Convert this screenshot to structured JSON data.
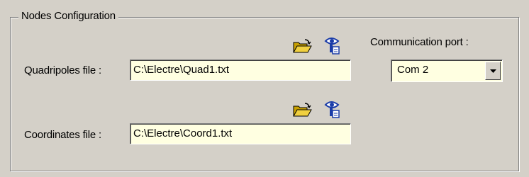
{
  "group": {
    "title": "Nodes Configuration"
  },
  "quadripoles": {
    "label": "Quadripoles file :",
    "value": "C:\\Electre\\Quad1.txt",
    "open_icon": "folder-open-icon",
    "view_icon": "view-file-icon"
  },
  "coordinates": {
    "label": "Coordinates file :",
    "value": "C:\\Electre\\Coord1.txt",
    "open_icon": "folder-open-icon",
    "view_icon": "view-file-icon"
  },
  "port": {
    "label": "Communication port :",
    "selected": "Com 2"
  },
  "colors": {
    "background": "#d4d0c8",
    "field_background": "#ffffe1",
    "folder": "#e8c020",
    "view_icon": "#2050c0"
  }
}
